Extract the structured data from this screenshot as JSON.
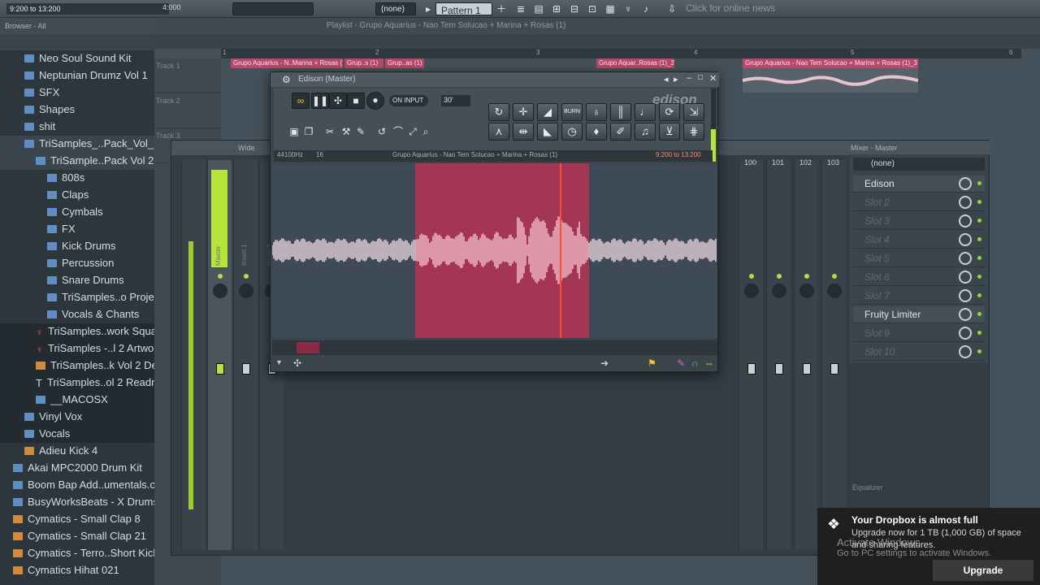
{
  "topbar": {
    "hint": "9:200 to 13:200",
    "time": "4:000",
    "none_label": "(none)",
    "pattern_label": "Pattern 1",
    "news": "Click for online news"
  },
  "browser": {
    "header": "Browser - All",
    "items": [
      {
        "label": "Neo Soul Sound Kit",
        "indent": 1,
        "kind": "folder"
      },
      {
        "label": "Neptunian Drumz Vol 1",
        "indent": 1,
        "kind": "folder"
      },
      {
        "label": "SFX",
        "indent": 1,
        "kind": "folder"
      },
      {
        "label": "Shapes",
        "indent": 1,
        "kind": "folder"
      },
      {
        "label": "shit",
        "indent": 1,
        "kind": "folder"
      },
      {
        "label": "TriSamples_..Pack_Vol_2",
        "indent": 1,
        "kind": "folder"
      },
      {
        "label": "TriSample..Pack Vol 2",
        "indent": 2,
        "kind": "folder"
      },
      {
        "label": "808s",
        "indent": 3,
        "kind": "folder"
      },
      {
        "label": "Claps",
        "indent": 3,
        "kind": "folder"
      },
      {
        "label": "Cymbals",
        "indent": 3,
        "kind": "folder"
      },
      {
        "label": "FX",
        "indent": 3,
        "kind": "folder"
      },
      {
        "label": "Kick Drums",
        "indent": 3,
        "kind": "folder"
      },
      {
        "label": "Percussion",
        "indent": 3,
        "kind": "folder"
      },
      {
        "label": "Snare Drums",
        "indent": 3,
        "kind": "folder"
      },
      {
        "label": "TriSamples..o Project",
        "indent": 3,
        "kind": "folder"
      },
      {
        "label": "Vocals & Chants",
        "indent": 3,
        "kind": "folder"
      },
      {
        "label": "TriSamples..work Square",
        "indent": 2,
        "kind": "image"
      },
      {
        "label": "TriSamples -..l 2 Artwork",
        "indent": 2,
        "kind": "image"
      },
      {
        "label": "TriSamples..k Vol 2 Demo",
        "indent": 2,
        "kind": "audio"
      },
      {
        "label": "TriSamples..ol 2 Readme",
        "indent": 2,
        "kind": "text"
      },
      {
        "label": "__MACOSX",
        "indent": 2,
        "kind": "folder"
      },
      {
        "label": "Vinyl Vox",
        "indent": 1,
        "kind": "folder"
      },
      {
        "label": "Vocals",
        "indent": 1,
        "kind": "folder"
      },
      {
        "label": "Adieu Kick 4",
        "indent": 1,
        "kind": "audio"
      },
      {
        "label": "Akai MPC2000 Drum Kit",
        "indent": 0,
        "kind": "folder"
      },
      {
        "label": "Boom Bap Add..umentals.com)",
        "indent": 0,
        "kind": "folder"
      },
      {
        "label": "BusyWorksBeats - X Drums",
        "indent": 0,
        "kind": "folder"
      },
      {
        "label": "Cymatics - Small Clap 8",
        "indent": 0,
        "kind": "audio"
      },
      {
        "label": "Cymatics - Small Clap 21",
        "indent": 0,
        "kind": "audio"
      },
      {
        "label": "Cymatics - Terro..Short Kick 001",
        "indent": 0,
        "kind": "audio"
      },
      {
        "label": "Cymatics Hihat 021",
        "indent": 0,
        "kind": "audio"
      }
    ]
  },
  "playlist": {
    "title": "Playlist - Grupo Aquarius - Nao Tem Solucao + Marina + Rosas (1)",
    "ruler_marks": [
      "1",
      "2",
      "3",
      "4",
      "5",
      "6"
    ],
    "tracks": [
      "Track 1",
      "Track 2",
      "Track 3"
    ],
    "clips": [
      "Grupo Aquarius - N..Marina + Rosas (1)",
      "Grup..s (1)",
      "Grup..as (1)",
      "Grupo Aquar..Rosas (1)_2",
      "Grupo Aquarius - Nao Tem Solucao + Marina + Rosas (1)_3"
    ]
  },
  "mixer": {
    "title": "Mixer - Master",
    "wide_label": "Wide",
    "preset": "(none)",
    "channel_names": [
      "Master",
      "Insert 1",
      "Insert 2"
    ],
    "right_channel_numbers": [
      "100",
      "101",
      "102",
      "103"
    ],
    "slots": [
      "Edison",
      "Slot 2",
      "Slot 3",
      "Slot 4",
      "Slot 5",
      "Slot 6",
      "Slot 7",
      "Fruity Limiter",
      "Slot 9",
      "Slot 10"
    ],
    "equalizer_label": "Equalizer"
  },
  "edison": {
    "title": "Edison (Master)",
    "brand": "edison",
    "input_mode": "ON INPUT",
    "length": "30'",
    "samplerate": "44100Hz",
    "format": "16",
    "file_name": "Grupo Aquarius - Nao Tem Solucao + Marina + Rosas (1)",
    "selection": "9:200 to 13:200"
  },
  "dropbox": {
    "title": "Your Dropbox is almost full",
    "message": "Upgrade now for 1 TB (1,000 GB) of space and sharing features.",
    "button": "Upgrade"
  },
  "activate": {
    "line1": "Activate Windows",
    "line2": "Go to PC settings to activate Windows."
  },
  "colors": {
    "selection": "#a23654",
    "playhead": "#ff4b2b",
    "clip": "#b8486c",
    "meter": "#b5e53a"
  }
}
